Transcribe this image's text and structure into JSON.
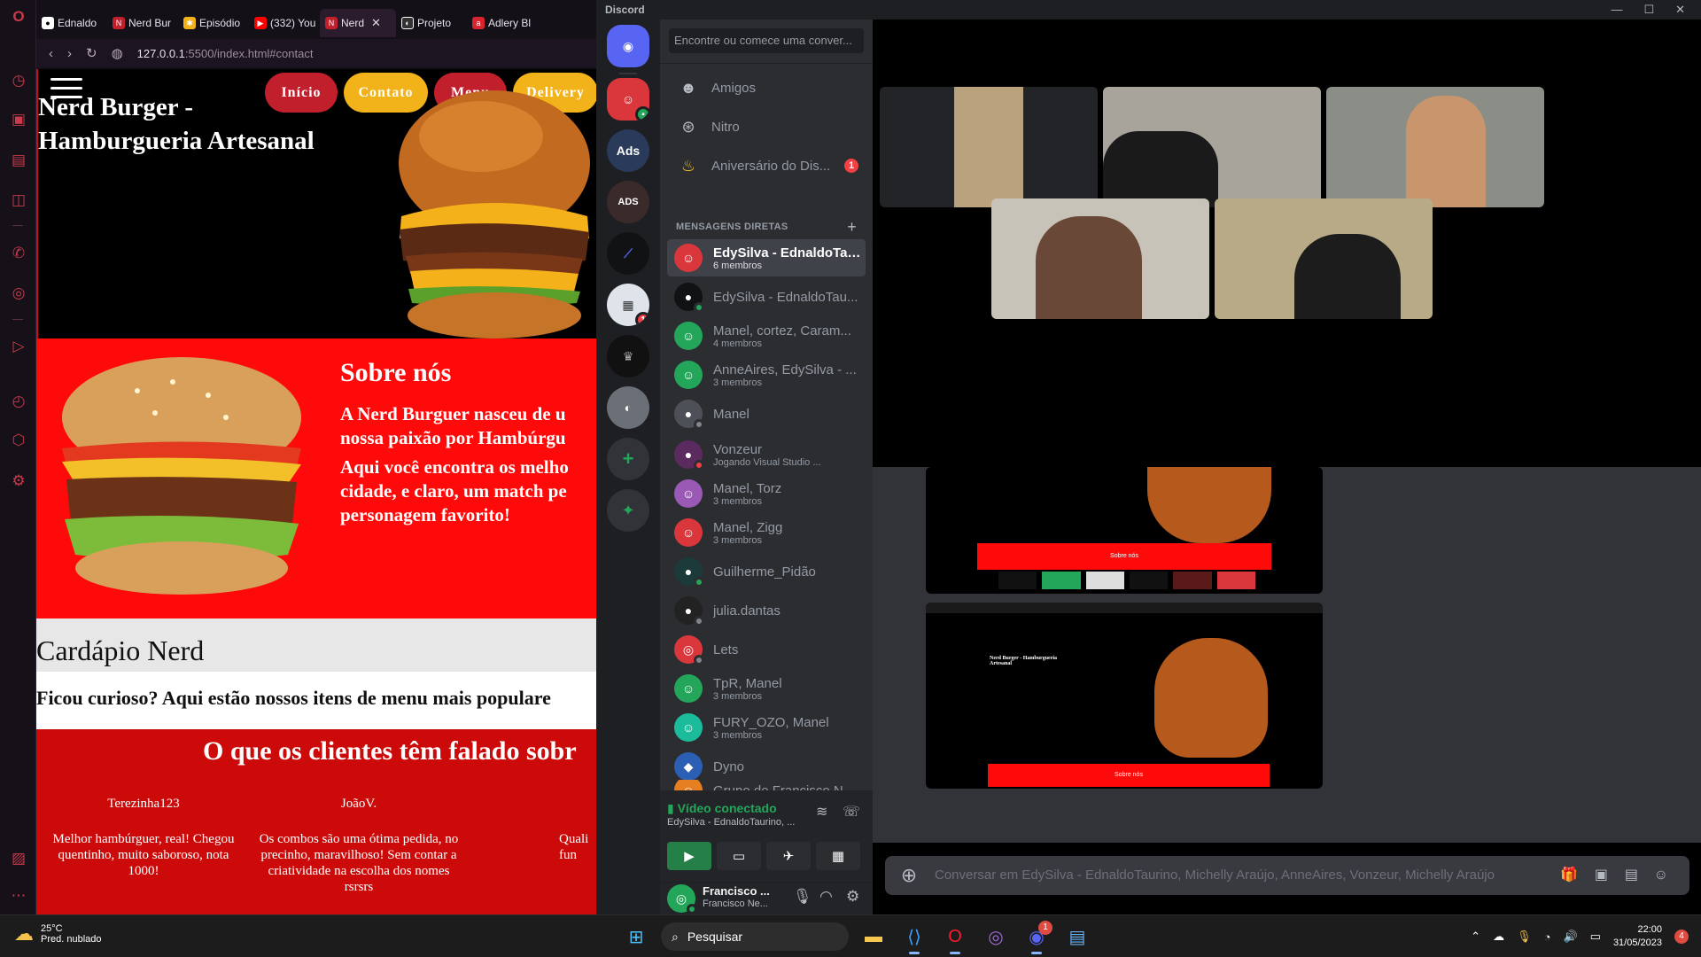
{
  "browser": {
    "tabs": [
      {
        "label": "Ednaldo",
        "icon": "github-icon",
        "color": "#ffffff"
      },
      {
        "label": "Nerd Bur",
        "icon": "nerd-favicon",
        "color": "#c11f2c"
      },
      {
        "label": "Episódio",
        "icon": "podcast-icon",
        "color": "#f2b21a"
      },
      {
        "label": "(332) You",
        "icon": "youtube-icon",
        "color": "#ff0000"
      },
      {
        "label": "Nerd",
        "icon": "nerd-favicon",
        "color": "#c11f2c",
        "active": true
      },
      {
        "label": "Projeto",
        "icon": "projeto-icon",
        "color": "#ffffff"
      },
      {
        "label": "Adlery Bl",
        "icon": "adlery-icon",
        "color": "#d9232e"
      }
    ],
    "url": "127.0.0.1",
    "url_rest": ":5500/index.html#contact"
  },
  "site": {
    "brand": "Nerd Burger - Hamburgueria Artesanal",
    "nav": [
      "Início",
      "Contato",
      "Menu",
      "Delivery"
    ],
    "about_title": "Sobre nós",
    "about_p1": "A Nerd Burguer nasceu de u nossa paixão por Hambúrgu",
    "about_p2": "Aqui você encontra os melho cidade, e claro, um match pe personagem favorito!",
    "menu_title": "Cardápio Nerd",
    "menu_sub": "Ficou curioso? Aqui estão nossos itens de menu mais populare",
    "reviews_title": "O que os clientes têm falado sobr",
    "reviews": [
      {
        "name": "Terezinha123",
        "text": "Melhor hambúrguer, real! Chegou quentinho, muito saboroso, nota 1000!"
      },
      {
        "name": "JoãoV.",
        "text": "Os combos são uma ótima pedida, no precinho, maravilhoso! Sem contar a criatividade na escolha dos nomes rsrsrs"
      },
      {
        "name": "",
        "text": "Quali fun"
      }
    ]
  },
  "discord": {
    "title": "Discord",
    "search_placeholder": "Encontre ou comece uma conver...",
    "nav": [
      {
        "label": "Amigos",
        "icon": "friends-icon"
      },
      {
        "label": "Nitro",
        "icon": "nitro-icon"
      },
      {
        "label": "Aniversário do Dis...",
        "icon": "cake-icon",
        "count": "1"
      }
    ],
    "dm_header": "MENSAGENS DIRETAS",
    "dms": [
      {
        "name": "EdySilva - EdnaldoTau...",
        "sub": "6 membros",
        "color": "#da373c",
        "selected": true
      },
      {
        "name": "EdySilva - EdnaldoTau...",
        "sub": "",
        "color": "#111214",
        "status": "#23a55a"
      },
      {
        "name": "Manel, cortez, Caram...",
        "sub": "4 membros",
        "color": "#23a55a"
      },
      {
        "name": "AnneAires, EdySilva - ...",
        "sub": "3 membros",
        "color": "#23a55a"
      },
      {
        "name": "Manel",
        "sub": "",
        "color": "#4e5058",
        "status": "#80848e"
      },
      {
        "name": "Vonzeur",
        "sub": "Jogando Visual Studio ...",
        "color": "#5b2a5e",
        "status": "#f23f43"
      },
      {
        "name": "Manel, Torz",
        "sub": "3 membros",
        "color": "#9b59b6"
      },
      {
        "name": "Manel, Zigg",
        "sub": "3 membros",
        "color": "#da373c"
      },
      {
        "name": "Guilherme_Pidão",
        "sub": "",
        "color": "#1d3a3a",
        "status": "#23a55a"
      },
      {
        "name": "julia.dantas",
        "sub": "",
        "color": "#222",
        "status": "#80848e"
      },
      {
        "name": "Lets",
        "sub": "",
        "color": "#da373c",
        "status": "#80848e"
      },
      {
        "name": "TpR, Manel",
        "sub": "3 membros",
        "color": "#23a55a"
      },
      {
        "name": "FURY_OZO, Manel",
        "sub": "3 membros",
        "color": "#1abc9c"
      },
      {
        "name": "Dyno",
        "sub": "",
        "color": "#2b5fb4"
      },
      {
        "name": "Grupo de Francisco N...",
        "sub": "",
        "color": "#e67e22"
      }
    ],
    "voice_status": "Vídeo conectado",
    "voice_channel": "EdySilva - EdnaldoTaurino, ...",
    "user_name": "Francisco ...",
    "user_sub": "Francisco Ne...",
    "chat_placeholder": "Conversar em EdySilva - EdnaldoTaurino, Michelly Araújo, AnneAires, Vonzeur, Michelly Araújo",
    "screen_titles": [
      "Sobre nós",
      "Nerd Burger - Hamburgueria Artesanal"
    ]
  },
  "taskbar": {
    "temp": "25°C",
    "weather": "Pred. nublado",
    "search": "Pesquisar",
    "time": "22:00",
    "date": "31/05/2023",
    "notifications": "4",
    "discord_badge": "1"
  },
  "colors": {
    "discord_blurple": "#5865f2",
    "discord_green": "#23a55a",
    "nerd_red": "#ff0a0a",
    "nerd_yellow": "#f2b21a"
  }
}
